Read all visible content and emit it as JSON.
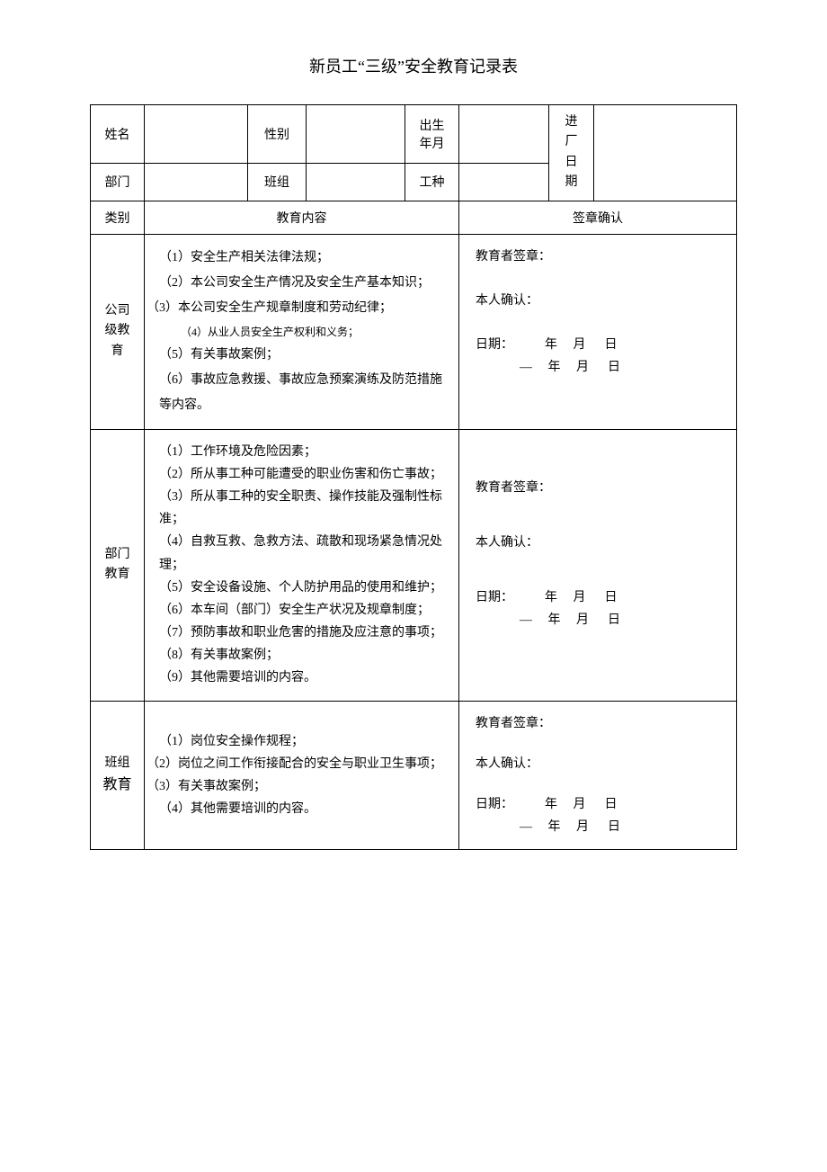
{
  "title": "新员工“三级”安全教育记录表",
  "header": {
    "name_label": "姓名",
    "gender_label": "性别",
    "birth_label_l1": "出生",
    "birth_label_l2": "年月",
    "entry_label_l1": "进",
    "entry_label_l2": "厂",
    "entry_label_l3": "日",
    "entry_label_l4": "期",
    "dept_label": "部门",
    "team_label": "班组",
    "jobtype_label": "工种",
    "cat_label": "类别",
    "content_label": "教育内容",
    "sign_label": "签章确认"
  },
  "levels": {
    "company": {
      "label_l1": "公司",
      "label_l2": "级教",
      "label_l3": "育",
      "items": [
        "（1）安全生产相关法律法规；",
        "（2）本公司安全生产情况及安全生产基本知识；",
        "（3）本公司安全生产规章制度和劳动纪律；",
        "（4）从业人员安全生产权利和义务；",
        "（5）有关事故案例；",
        "（6）事故应急救援、事故应急预案演练及防范措施等内容。"
      ]
    },
    "dept": {
      "label_l1": "部门",
      "label_l2": "教育",
      "items": [
        "（1）工作环境及危险因素；",
        "（2）所从事工种可能遭受的职业伤害和伤亡事故；",
        "（3）所从事工种的安全职责、操作技能及强制性标准；",
        "（4）自救互救、急救方法、疏散和现场紧急情况处理；",
        "（5）安全设备设施、个人防护用品的使用和维护；",
        "（6）本车间（部门）安全生产状况及规章制度；",
        "（7）预防事故和职业危害的措施及应注意的事项；",
        "（8）有关事故案例；",
        "（9）其他需要培训的内容。"
      ]
    },
    "team": {
      "label_l1": "班组",
      "label_l2": "教育",
      "items": [
        "（1）岗位安全操作规程；",
        "（2）岗位之间工作衔接配合的安全与职业卫生事项；",
        "（3）有关事故案例；",
        "（4）其他需要培训的内容。"
      ]
    }
  },
  "sign": {
    "educator": "教育者签章：",
    "self": "本人确认：",
    "date_line1": "日期：          年     月      日",
    "date_line2": "—     年     月      日"
  }
}
